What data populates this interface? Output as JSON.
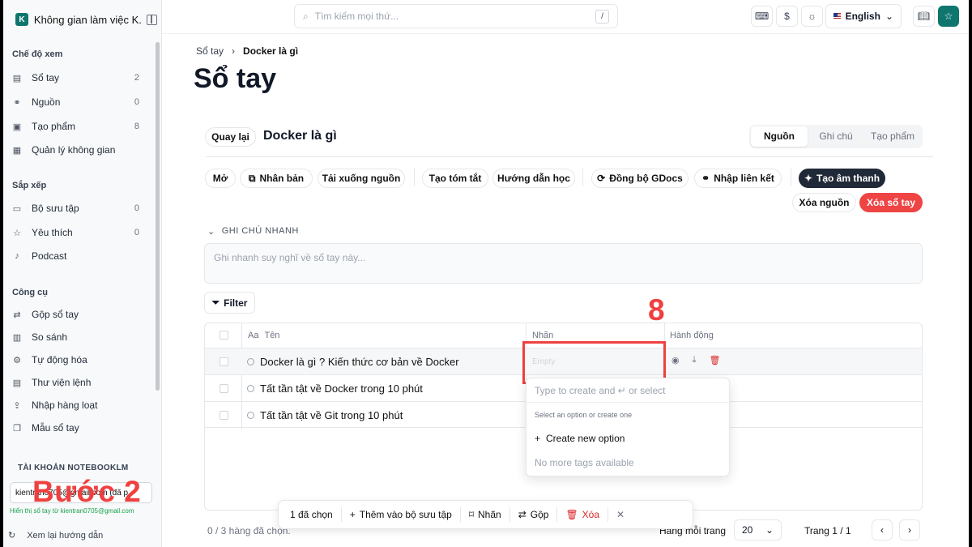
{
  "workspace": {
    "logo": "K",
    "title": "Không gian làm việc K..."
  },
  "sidebar": {
    "view_title": "Chế độ xem",
    "view_items": [
      {
        "label": "Sổ tay",
        "count": "2",
        "icon": "notebook-icon"
      },
      {
        "label": "Nguồn",
        "count": "0",
        "icon": "link-icon"
      },
      {
        "label": "Tạo phẩm",
        "count": "8",
        "icon": "artifact-icon"
      },
      {
        "label": "Quản lý không gian",
        "count": "",
        "icon": "workspace-icon"
      }
    ],
    "arrange_title": "Sắp xếp",
    "arrange_items": [
      {
        "label": "Bộ sưu tập",
        "count": "0",
        "icon": "folder-icon"
      },
      {
        "label": "Yêu thích",
        "count": "0",
        "icon": "star-icon"
      },
      {
        "label": "Podcast",
        "count": "",
        "icon": "mic-icon"
      }
    ],
    "tools_title": "Công cụ",
    "tools_items": [
      {
        "label": "Gộp sổ tay",
        "icon": "merge-icon"
      },
      {
        "label": "So sánh",
        "icon": "compare-icon"
      },
      {
        "label": "Tự động hóa",
        "icon": "gear-icon"
      },
      {
        "label": "Thư viện lệnh",
        "icon": "library-icon"
      },
      {
        "label": "Nhập hàng loạt",
        "icon": "upload-icon"
      },
      {
        "label": "Mẫu sổ tay",
        "icon": "template-icon"
      }
    ],
    "account_title": "TÀI KHOẢN NOTEBOOKLM",
    "account_value": "kientran0705@gmail.com (đã p",
    "account_note": "Hiển thị sổ tay từ kientran0705@gmail.com",
    "guide": "Xem lại hướng dẫn"
  },
  "topbar": {
    "search_placeholder": "Tìm kiếm mọi thứ...",
    "search_shortcut": "/",
    "language": "English"
  },
  "breadcrumb": {
    "root": "Sổ tay",
    "current": "Docker là gì"
  },
  "page_title": "Sổ tay",
  "notebook": {
    "back": "Quay lại",
    "title": "Docker là gì",
    "tabs": [
      "Nguồn",
      "Ghi chú",
      "Tạo phẩm"
    ],
    "active_tab": "Nguồn"
  },
  "actions": {
    "open": "Mở",
    "duplicate": "Nhân bản",
    "download": "Tải xuống nguồn",
    "summary": "Tạo tóm tắt",
    "guide": "Hướng dẫn học",
    "sync": "Đồng bộ GDocs",
    "import_link": "Nhập liên kết",
    "audio": "Tạo âm thanh",
    "delete_source": "Xóa nguồn",
    "delete_notebook": "Xóa sổ tay"
  },
  "quick_note": {
    "title": "GHI CHÚ NHANH",
    "placeholder": "Ghi nhanh suy nghĩ về sổ tay này..."
  },
  "filter_label": "Filter",
  "table": {
    "col_name_prefix": "Aa",
    "col_name": "Tên",
    "col_tags": "Nhãn",
    "col_actions": "Hành động",
    "rows": [
      {
        "name": "Docker là gì ? Kiến thức cơ bản về Docker",
        "tags": "Empty"
      },
      {
        "name": "Tất tần tật về Docker trong 10 phút",
        "tags": ""
      },
      {
        "name": "Tất tần tật về Git trong 10 phút",
        "tags": ""
      }
    ]
  },
  "dropdown": {
    "input_placeholder": "Type to create and ↵ or select",
    "hint": "Select an option or create one",
    "create": "Create new option",
    "none": "No more tags available"
  },
  "bulk": {
    "selected": "1 đã chọn",
    "add_collection": "Thêm vào bộ sưu tập",
    "tag": "Nhãn",
    "merge": "Gộp",
    "delete": "Xóa"
  },
  "footer": {
    "rows_selected": "0 / 3 hàng đã chọn.",
    "rows_per_page": "Hàng mỗi trang",
    "page_size": "20",
    "page": "Trang 1 / 1"
  },
  "annotations": {
    "step": "Bước 2",
    "number": "8"
  },
  "colors": {
    "accent": "#0f766e",
    "danger": "#ef4444",
    "annotation": "#ef4040"
  }
}
